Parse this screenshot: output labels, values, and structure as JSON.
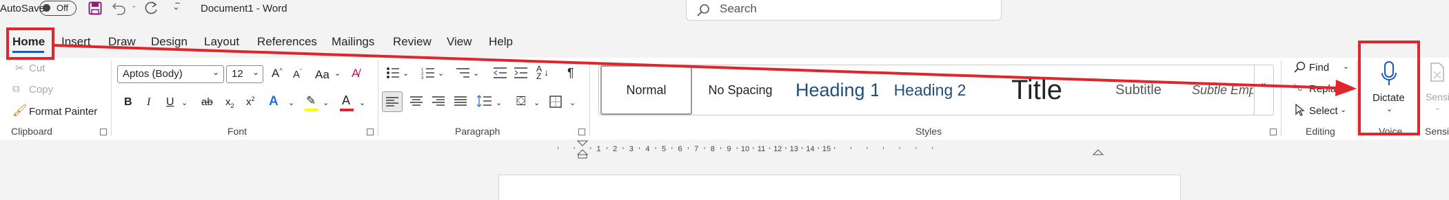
{
  "titlebar": {
    "autosave_label": "AutoSave",
    "autosave_state": "Off",
    "document_title": "Document1  -  Word",
    "search_placeholder": "Search"
  },
  "tabs": [
    "Home",
    "Insert",
    "Draw",
    "Design",
    "Layout",
    "References",
    "Mailings",
    "Review",
    "View",
    "Help"
  ],
  "clipboard": {
    "cut": "Cut",
    "copy": "Copy",
    "format_painter": "Format Painter",
    "label": "Clipboard"
  },
  "font": {
    "family": "Aptos (Body)",
    "size": "12",
    "change_case": "Aa",
    "label": "Font"
  },
  "paragraph": {
    "label": "Paragraph"
  },
  "styles": {
    "items": [
      "Normal",
      "No Spacing",
      "Heading 1",
      "Heading 2",
      "Title",
      "Subtitle",
      "Subtle Emphasis"
    ],
    "label": "Styles"
  },
  "editing": {
    "find": "Find",
    "replace": "Replace",
    "select": "Select",
    "label": "Editing"
  },
  "voice": {
    "dictate": "Dictate",
    "label": "Voice"
  },
  "sensitivity": {
    "button": "Sensitivity",
    "label": "Sensitivity"
  },
  "ruler": {
    "labels": [
      "1",
      "2",
      "3",
      "4",
      "5",
      "6",
      "7",
      "8",
      "9",
      "10",
      "11",
      "12",
      "13",
      "14",
      "15"
    ]
  },
  "colors": {
    "annotation": "#e0252b",
    "highlight": "#ffff00",
    "font_color": "#e0252b",
    "accent": "#185abd"
  }
}
